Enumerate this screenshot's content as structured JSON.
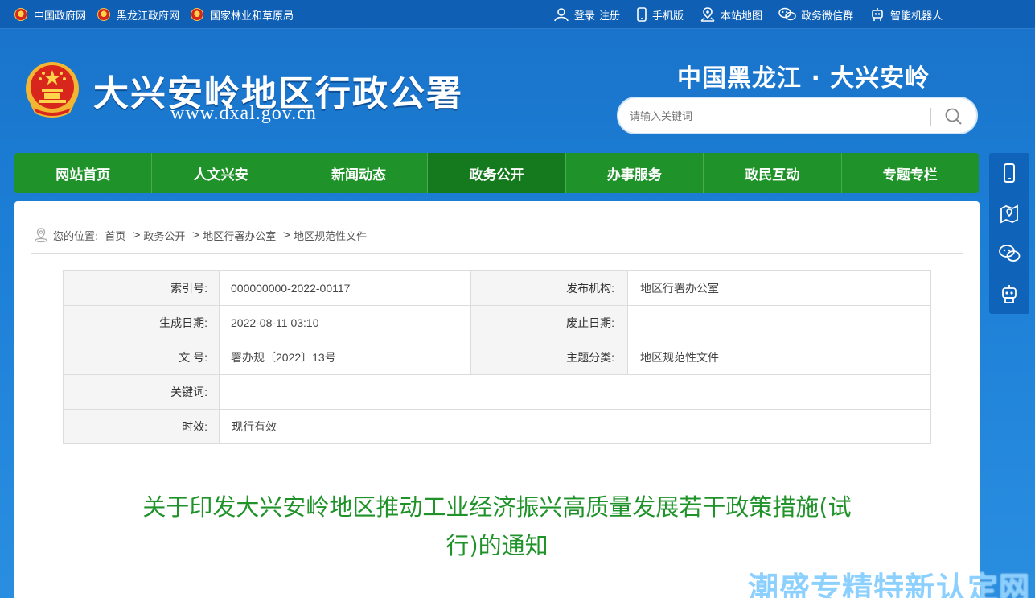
{
  "topbar": {
    "left_links": [
      {
        "label": "中国政府网"
      },
      {
        "label": "黑龙江政府网"
      },
      {
        "label": "国家林业和草原局"
      }
    ],
    "login": "登录",
    "register": "注册",
    "mobile": "手机版",
    "sitemap": "本站地图",
    "wechat": "政务微信群",
    "robot": "智能机器人"
  },
  "header": {
    "site_title": "大兴安岭地区行政公署",
    "site_url": "www.dxal.gov.cn",
    "region_title": "中国黑龙江 · 大兴安岭",
    "search_placeholder": "请输入关键词"
  },
  "nav": {
    "items": [
      {
        "label": "网站首页"
      },
      {
        "label": "人文兴安"
      },
      {
        "label": "新闻动态"
      },
      {
        "label": "政务公开"
      },
      {
        "label": "办事服务"
      },
      {
        "label": "政民互动"
      },
      {
        "label": "专题专栏"
      }
    ],
    "active_index": 3
  },
  "breadcrumb": {
    "prefix": "您的位置:",
    "items": [
      "首页",
      "政务公开",
      "地区行署办公室",
      "地区规范性文件"
    ],
    "separator": ">"
  },
  "meta": {
    "index_label": "索引号:",
    "index_value": "000000000-2022-00117",
    "publisher_label": "发布机构:",
    "publisher_value": "地区行署办公室",
    "created_label": "生成日期:",
    "created_value": "2022-08-11 03:10",
    "expire_label": "废止日期:",
    "expire_value": "",
    "docno_label": "文 号:",
    "docno_value": "署办规〔2022〕13号",
    "topic_label": "主题分类:",
    "topic_value": "地区规范性文件",
    "keywords_label": "关键词:",
    "keywords_value": "",
    "validity_label": "时效:",
    "validity_value": "现行有效"
  },
  "document": {
    "title_line1": "关于印发大兴安岭地区推动工业经济振兴高质量发展若干政策措施(试",
    "title_line2": "行)的通知"
  },
  "watermark": "潮盛专精特新认定网",
  "colors": {
    "nav_green": "#1f9329",
    "nav_active": "#147a1d",
    "title_green": "#1f9329",
    "top_blue": "#0f5fb4",
    "bg_blue": "#1c7fd6"
  }
}
